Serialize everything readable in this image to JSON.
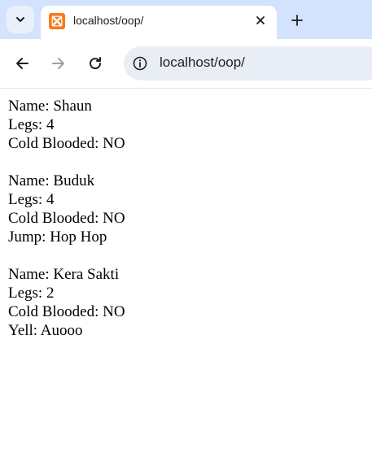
{
  "browser": {
    "tab_title": "localhost/oop/",
    "url": "localhost/oop/",
    "favicon_color": "#f57c1f",
    "tabbar_color": "#d3e3fd"
  },
  "page": {
    "animals": [
      {
        "name": "Name: Shaun",
        "legs": "Legs: 4",
        "cold_blooded": "Cold Blooded: NO"
      },
      {
        "name": "Name: Buduk",
        "legs": "Legs: 4",
        "cold_blooded": "Cold Blooded: NO",
        "action": "Jump: Hop Hop"
      },
      {
        "name": "Name: Kera Sakti",
        "legs": "Legs: 2",
        "cold_blooded": "Cold Blooded: NO",
        "action": "Yell: Auooo"
      }
    ]
  }
}
